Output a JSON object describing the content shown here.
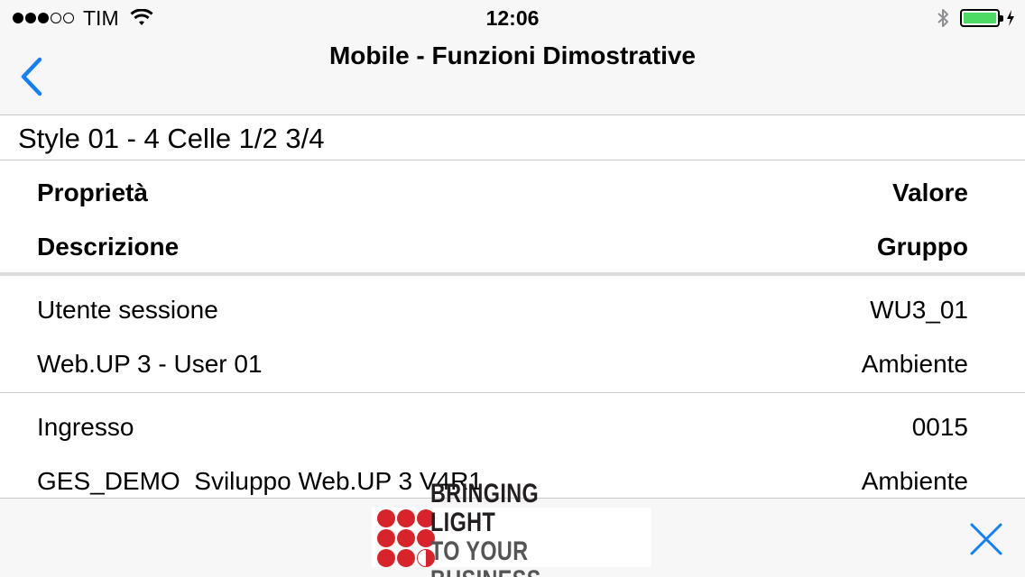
{
  "status_bar": {
    "signal_filled": 3,
    "signal_total": 5,
    "carrier": "TIM",
    "time": "12:06",
    "icons": [
      "wifi-icon",
      "bluetooth-icon",
      "battery-icon",
      "charging-icon"
    ],
    "battery_level": 1.0,
    "battery_color": "#4cd964"
  },
  "nav": {
    "back_icon": "chevron-left-icon",
    "title": "Mobile - Funzioni Dimostrative",
    "accent_color": "#147efb"
  },
  "section": {
    "title": "Style 01 - 4 Celle 1/2 3/4"
  },
  "table": {
    "header": {
      "top_left": "Proprietà",
      "top_right": "Valore",
      "bottom_left": "Descrizione",
      "bottom_right": "Gruppo"
    },
    "rows": [
      {
        "top_left": "Utente sessione",
        "top_right": "WU3_01",
        "bottom_left": "Web.UP 3 - User 01",
        "bottom_right": "Ambiente"
      },
      {
        "top_left": "Ingresso",
        "top_right": "0015",
        "bottom_left": "GES_DEMO  Sviluppo Web.UP 3 V4R1",
        "bottom_right": "Ambiente"
      }
    ]
  },
  "bottom_bar": {
    "logo": {
      "line1": "BRINGING LIGHT",
      "line2": "TO YOUR BUSINESS",
      "brand_color": "#d8232a"
    },
    "close_icon": "close-icon"
  }
}
